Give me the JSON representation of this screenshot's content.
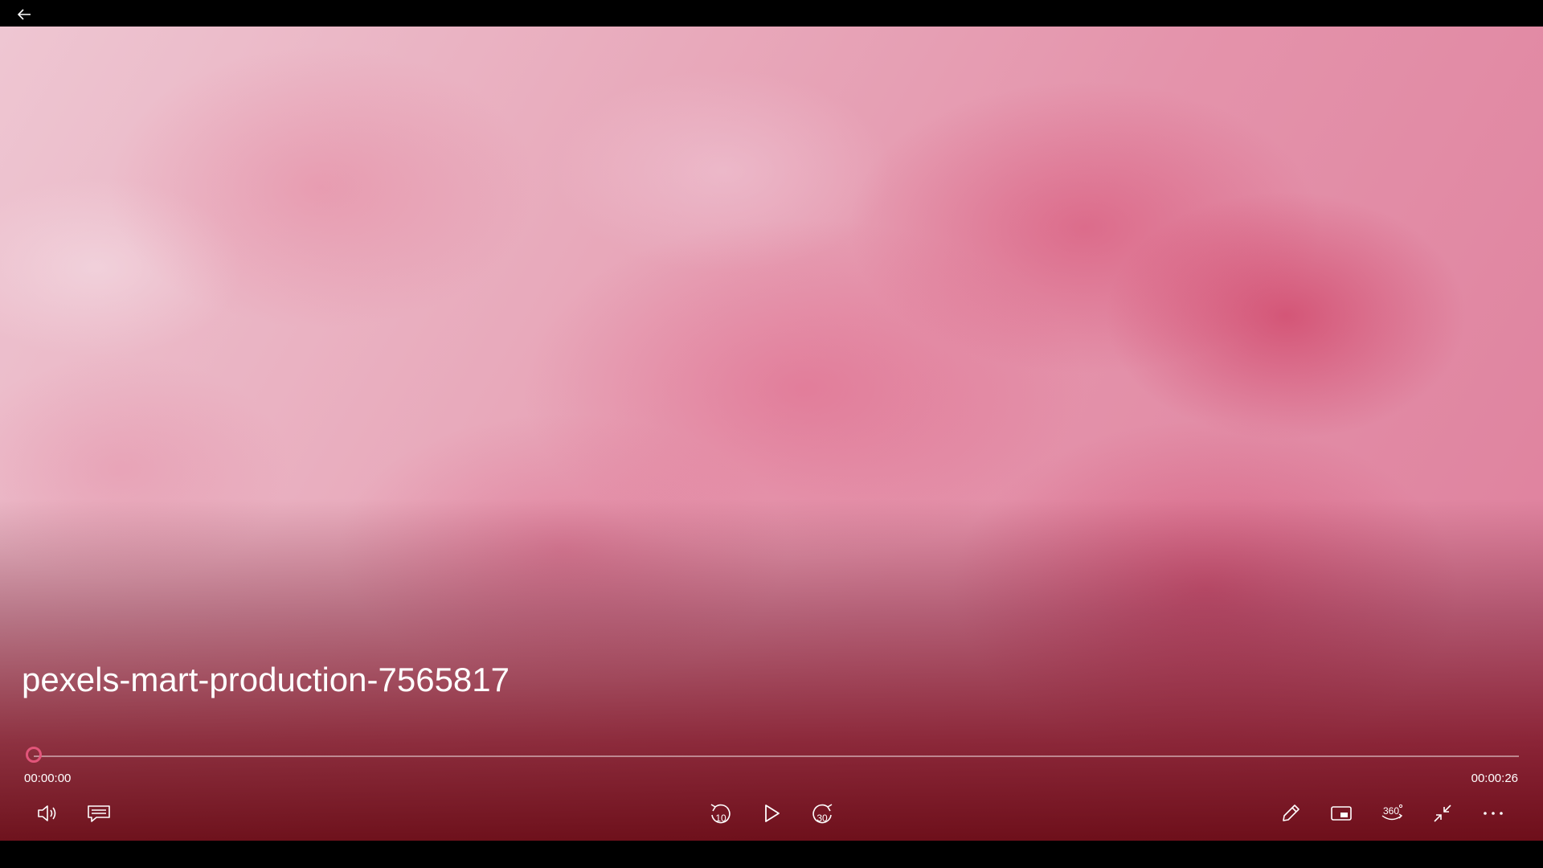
{
  "window": {
    "back_button_icon": "arrow-left-icon"
  },
  "video": {
    "title": "pexels-mart-production-7565817",
    "progress_fraction": 0.0
  },
  "playback": {
    "elapsed_time": "00:00:00",
    "total_time": "00:00:26",
    "seek_thumb_color": "#e2557a"
  },
  "controls": {
    "left": [
      {
        "name": "volume-button",
        "icon": "speaker-icon"
      },
      {
        "name": "captions-button",
        "icon": "captions-icon"
      }
    ],
    "center": [
      {
        "name": "skip-back-10-button",
        "icon": "rewind-10-icon",
        "label": "10"
      },
      {
        "name": "play-button",
        "icon": "play-icon"
      },
      {
        "name": "skip-forward-30-button",
        "icon": "forward-30-icon",
        "label": "30"
      }
    ],
    "right": [
      {
        "name": "edit-button",
        "icon": "pencil-icon"
      },
      {
        "name": "mini-view-button",
        "icon": "mini-view-icon"
      },
      {
        "name": "360-video-button",
        "icon": "360-icon",
        "label": "360"
      },
      {
        "name": "exit-fullscreen-button",
        "icon": "exit-fullscreen-icon"
      },
      {
        "name": "more-options-button",
        "icon": "ellipsis-icon"
      }
    ]
  }
}
